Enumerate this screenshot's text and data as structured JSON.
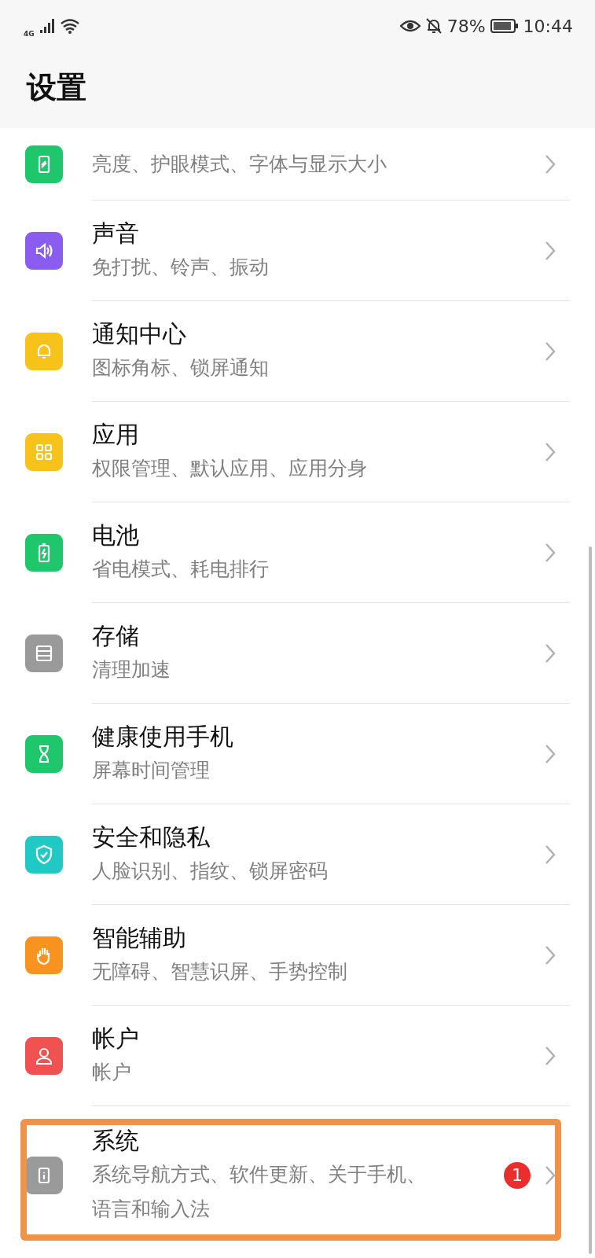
{
  "status_bar": {
    "network": "4G",
    "battery_percent": "78%",
    "time": "10:44"
  },
  "header": {
    "title": "设置"
  },
  "items": [
    {
      "subtitle": "亮度、护眼模式、字体与显示大小",
      "color": "#1ec76b",
      "highlighted": false
    },
    {
      "title": "声音",
      "subtitle": "免打扰、铃声、振动",
      "color": "#8a5cf0",
      "highlighted": false
    },
    {
      "title": "通知中心",
      "subtitle": "图标角标、锁屏通知",
      "color": "#f7c21a",
      "highlighted": false
    },
    {
      "title": "应用",
      "subtitle": "权限管理、默认应用、应用分身",
      "color": "#f7c21a",
      "highlighted": false
    },
    {
      "title": "电池",
      "subtitle": "省电模式、耗电排行",
      "color": "#1ec76b",
      "highlighted": false
    },
    {
      "title": "存储",
      "subtitle": "清理加速",
      "color": "#9a9a9a",
      "highlighted": false
    },
    {
      "title": "健康使用手机",
      "subtitle": "屏幕时间管理",
      "color": "#1ec76b",
      "highlighted": false
    },
    {
      "title": "安全和隐私",
      "subtitle": "人脸识别、指纹、锁屏密码",
      "color": "#20c9c4",
      "highlighted": false
    },
    {
      "title": "智能辅助",
      "subtitle": "无障碍、智慧识屏、手势控制",
      "color": "#f7931e",
      "highlighted": false
    },
    {
      "title": "帐户",
      "subtitle": "帐户",
      "color": "#f05252",
      "highlighted": false
    },
    {
      "title": "系统",
      "subtitle": "系统导航方式、软件更新、关于手机、语言和输入法",
      "color": "#9a9a9a",
      "badge": "1",
      "highlighted": true
    }
  ]
}
